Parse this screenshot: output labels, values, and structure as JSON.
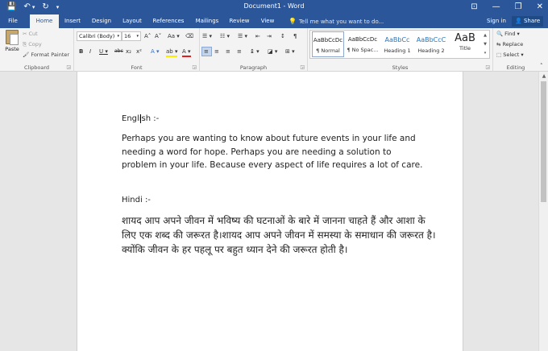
{
  "titlebar": {
    "title": "Document1 - Word",
    "qat": {
      "save_icon": "💾",
      "undo_icon": "↶",
      "undo_dd": "▾",
      "redo_icon": "↻",
      "custom_icon": "▾"
    },
    "window_buttons": {
      "ribbon_options": "⊡",
      "minimize": "—",
      "restore": "❐",
      "close": "✕"
    }
  },
  "tabs": [
    "File",
    "Home",
    "Insert",
    "Design",
    "Layout",
    "References",
    "Mailings",
    "Review",
    "View"
  ],
  "active_tab": "Home",
  "tell_me": {
    "icon": "💡",
    "placeholder": "Tell me what you want to do..."
  },
  "signin": "Sign in",
  "share": "Share",
  "ribbon": {
    "clipboard": {
      "label": "Clipboard",
      "paste": "Paste",
      "cut": "✂ Cut",
      "copy": "⎘ Copy",
      "format_painter": "🖌 Format Painter"
    },
    "font": {
      "label": "Font",
      "font_name": "Calibri (Body)",
      "font_size": "16",
      "grow": "A˄",
      "shrink": "A˅",
      "change_case": "Aa ▾",
      "clear": "⌫",
      "bold": "B",
      "italic": "I",
      "underline": "U ▾",
      "strike": "abc",
      "subscript": "x₂",
      "superscript": "x²",
      "effects": "A ▾",
      "highlight": "ab ▾",
      "color": "A ▾"
    },
    "paragraph": {
      "label": "Paragraph",
      "bullets": "☰ ▾",
      "numbering": "☷ ▾",
      "multilevel": "☰ ▾",
      "decrease_indent": "⇤",
      "increase_indent": "⇥",
      "sort": "↕",
      "show_marks": "¶",
      "align_left": "≡",
      "center": "≡",
      "align_right": "≡",
      "justify": "≡",
      "line_spacing": "↨ ▾",
      "shading": "◪ ▾",
      "borders": "⊞ ▾"
    },
    "styles": {
      "label": "Styles",
      "items": [
        {
          "preview": "AaBbCcDc",
          "name": "¶ Normal"
        },
        {
          "preview": "AaBbCcDc",
          "name": "¶ No Spac..."
        },
        {
          "preview": "AaBbCc",
          "name": "Heading 1"
        },
        {
          "preview": "AaBbCcC",
          "name": "Heading 2"
        },
        {
          "preview": "AaB",
          "name": "Title"
        }
      ],
      "arrow_up": "▲",
      "arrow_down": "▼",
      "more": "▾"
    },
    "editing": {
      "label": "Editing",
      "find": "🔍 Find ▾",
      "replace": "⇆ Replace",
      "select": "⬚ Select ▾"
    },
    "collapse": "˄"
  },
  "document": {
    "english_heading": "English :-",
    "english_para": "Perhaps you are wanting to know about future events in your life and needing a word for hope. Perhaps you are needing a solution to problem in your life. Because every aspect of life requires a lot of care.",
    "hindi_heading": "Hindi :-",
    "hindi_para": "शायद आप अपने जीवन में भविष्य की घटनाओं के बारे में जानना चाहते हैं और आशा के लिए एक शब्द की जरूरत है।शायद आप अपने जीवन में समस्या के समाधान की जरूरत है।क्योंकि जीवन के हर पहलू पर बहुत ध्यान देने की जरूरत होती है।"
  },
  "scrollbar": {
    "up_arrow": "▲"
  }
}
